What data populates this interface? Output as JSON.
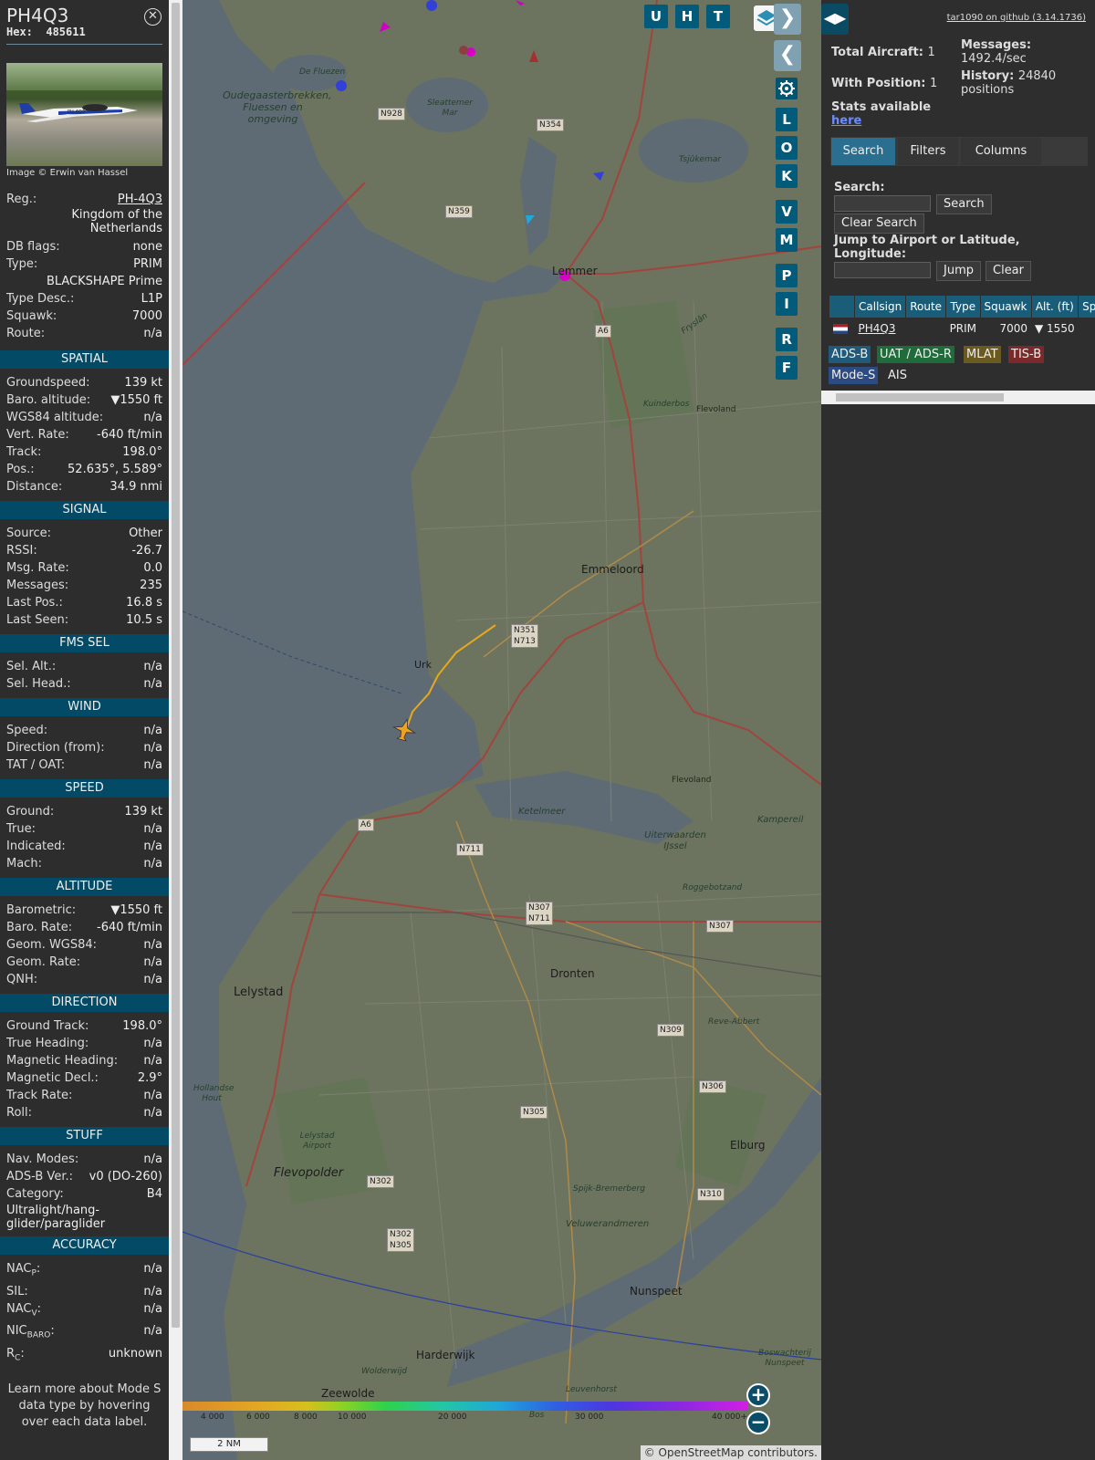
{
  "aircraft": {
    "callsign": "PH4Q3",
    "hex_label": "Hex:",
    "hex": "485611",
    "image_credit": "Image © Erwin van Hassel",
    "photo_reg": "PH-4Q3"
  },
  "details": [
    {
      "k": "Reg.:",
      "v": "PH-4Q3",
      "link": true
    },
    {
      "k": "",
      "v": "Kingdom of the Netherlands"
    },
    {
      "k": "DB flags:",
      "v": "none"
    },
    {
      "k": "Type:",
      "v": "PRIM"
    },
    {
      "k": "",
      "v": "BLACKSHAPE Prime"
    },
    {
      "k": "Type Desc.:",
      "v": "L1P"
    },
    {
      "k": "Squawk:",
      "v": "7000"
    },
    {
      "k": "Route:",
      "v": "n/a"
    }
  ],
  "sections": {
    "spatial": {
      "title": "SPATIAL",
      "rows": [
        {
          "k": "Groundspeed:",
          "v": "139 kt"
        },
        {
          "k": "Baro. altitude:",
          "v": "▼1550 ft"
        },
        {
          "k": "WGS84 altitude:",
          "v": "n/a"
        },
        {
          "k": "Vert. Rate:",
          "v": "-640 ft/min"
        },
        {
          "k": "Track:",
          "v": "198.0°"
        },
        {
          "k": "Pos.:",
          "v": "52.635°, 5.589°"
        },
        {
          "k": "Distance:",
          "v": "34.9 nmi"
        }
      ]
    },
    "signal": {
      "title": "SIGNAL",
      "rows": [
        {
          "k": "Source:",
          "v": "Other"
        },
        {
          "k": "RSSI:",
          "v": "-26.7"
        },
        {
          "k": "Msg. Rate:",
          "v": "0.0"
        },
        {
          "k": "Messages:",
          "v": "235"
        },
        {
          "k": "Last Pos.:",
          "v": "16.8 s"
        },
        {
          "k": "Last Seen:",
          "v": "10.5 s"
        }
      ]
    },
    "fms": {
      "title": "FMS SEL",
      "rows": [
        {
          "k": "Sel. Alt.:",
          "v": "n/a"
        },
        {
          "k": "Sel. Head.:",
          "v": "n/a"
        }
      ]
    },
    "wind": {
      "title": "WIND",
      "rows": [
        {
          "k": "Speed:",
          "v": "n/a"
        },
        {
          "k": "Direction (from):",
          "v": "n/a"
        },
        {
          "k": "TAT / OAT:",
          "v": "n/a"
        }
      ]
    },
    "speed": {
      "title": "SPEED",
      "rows": [
        {
          "k": "Ground:",
          "v": "139 kt"
        },
        {
          "k": "True:",
          "v": "n/a"
        },
        {
          "k": "Indicated:",
          "v": "n/a"
        },
        {
          "k": "Mach:",
          "v": "n/a"
        }
      ]
    },
    "altitude": {
      "title": "ALTITUDE",
      "rows": [
        {
          "k": "Barometric:",
          "v": "▼1550 ft"
        },
        {
          "k": "Baro. Rate:",
          "v": "-640 ft/min"
        },
        {
          "k": "Geom. WGS84:",
          "v": "n/a"
        },
        {
          "k": "Geom. Rate:",
          "v": "n/a"
        },
        {
          "k": "QNH:",
          "v": "n/a"
        }
      ]
    },
    "direction": {
      "title": "DIRECTION",
      "rows": [
        {
          "k": "Ground Track:",
          "v": "198.0°"
        },
        {
          "k": "True Heading:",
          "v": "n/a"
        },
        {
          "k": "Magnetic Heading:",
          "v": "n/a"
        },
        {
          "k": "Magnetic Decl.:",
          "v": "2.9°"
        },
        {
          "k": "Track Rate:",
          "v": "n/a"
        },
        {
          "k": "Roll:",
          "v": "n/a"
        }
      ]
    },
    "stuff": {
      "title": "STUFF",
      "rows": [
        {
          "k": "Nav. Modes:",
          "v": "n/a"
        },
        {
          "k": "ADS-B Ver.:",
          "v": "v0 (DO-260)"
        },
        {
          "k": "Category:",
          "v": "B4"
        }
      ],
      "category_desc": "Ultralight/hang-glider/paraglider"
    },
    "accuracy": {
      "title": "ACCURACY",
      "rows": [
        {
          "k": "NAC",
          "sub": "P",
          "v": "n/a"
        },
        {
          "k": "SIL:",
          "sub": "",
          "v": "n/a"
        },
        {
          "k": "NAC",
          "sub": "V",
          "v": "n/a"
        },
        {
          "k": "NIC",
          "sub": "BARO",
          "v": "n/a"
        },
        {
          "k": "R",
          "sub": "C",
          "v": "unknown"
        }
      ]
    }
  },
  "learn_more": "Learn more about Mode S data type by hovering over each data label.",
  "map": {
    "top_buttons": [
      "U",
      "H",
      "T"
    ],
    "side_buttons": [
      "L",
      "O",
      "K",
      "V",
      "M",
      "P",
      "I",
      "R",
      "F"
    ],
    "labels": {
      "oudega": "Oudegaasterbrekken, Fluessen en omgeving",
      "defluezen": "De Fluezen",
      "sleattemer": "Sleattemer Mar",
      "tsjukemar": "Tsjûkemar",
      "lemmer": "Lemmer",
      "frysland": "Fryslân",
      "kuinderbos": "Kuinderbos",
      "flevoland1": "Flevoland",
      "emmeloord": "Emmeloord",
      "urk": "Urk",
      "ketelmeer": "Ketelmeer",
      "uiterwaarden": "Uiterwaarden IJssel",
      "kampereil": "Kampereil",
      "roggebotzand": "Roggebotzand",
      "flevoland2": "Flevoland",
      "lelystad": "Lelystad",
      "dronten": "Dronten",
      "reveabbert": "Reve-Abbert",
      "hollandse": "Hollandse Hout",
      "lelystadairport": "Lelystad Airport",
      "flevopolder": "Flevopolder",
      "elburg": "Elburg",
      "spijk": "Spijk-Bremerberg",
      "veluwerand": "Veluwerandmeren",
      "nunspeet": "Nunspeet",
      "harderwijk": "Harderwijk",
      "zeewolde": "Zeewolde",
      "leuvenhorst": "Leuvenhorst",
      "boswachterij": "Boswachterij Nunspeet",
      "wolderwijd": "Wolderwijd",
      "bos": "Bos"
    },
    "roads": {
      "n928": "N928",
      "n354": "N354",
      "n359": "N359",
      "a6a": "A6",
      "n351": "N351",
      "n713": "N713",
      "a6b": "A6",
      "n711": "N711",
      "n307a": "N307",
      "n711b": "N711",
      "n307b": "N307",
      "n309": "N309",
      "n306": "N306",
      "n305": "N305",
      "n302a": "N302",
      "n302b": "N302",
      "n305b": "N305",
      "n310": "N310"
    },
    "alt_ticks": [
      "4 000",
      "6 000",
      "8 000",
      "10 000",
      "20 000",
      "30 000",
      "40 000+"
    ],
    "scale": "2 NM",
    "attribution": "© OpenStreetMap contributors."
  },
  "right": {
    "github": "tar1090 on github (3.14.1736)",
    "total_aircraft_label": "Total Aircraft:",
    "total_aircraft": "1",
    "with_position_label": "With Position:",
    "with_position": "1",
    "messages_label": "Messages:",
    "messages": "1492.4/sec",
    "history_label": "History:",
    "history": "24840 positions",
    "stats_label": "Stats available",
    "stats_link": "here",
    "tabs": [
      "Search",
      "Filters",
      "Columns"
    ],
    "search_label": "Search:",
    "search_value": "",
    "search_button": "Search",
    "clear_search_button": "Clear Search",
    "jump_label": "Jump to Airport or Latitude, Longitude:",
    "jump_value": "",
    "jump_button": "Jump",
    "clear_button": "Clear",
    "table_headers": [
      "",
      "Callsign",
      "Route",
      "Type",
      "Squawk",
      "Alt. (ft)",
      "Spd"
    ],
    "table_row": {
      "callsign": "PH4Q3",
      "route": "",
      "type": "PRIM",
      "squawk": "7000",
      "alt": "▼ 1550",
      "spd": ""
    },
    "source_tags": [
      "ADS-B",
      "UAT / ADS-R",
      "MLAT",
      "TIS-B",
      "Mode-S",
      "AIS"
    ],
    "tag_colors": {
      "adsb": "#1f5a7a",
      "uat": "#1f6b3a",
      "mlat": "#6b5a1f",
      "tisb": "#7a2a2a",
      "modes": "#2c4b82",
      "ais": "#2e2e2e"
    }
  }
}
